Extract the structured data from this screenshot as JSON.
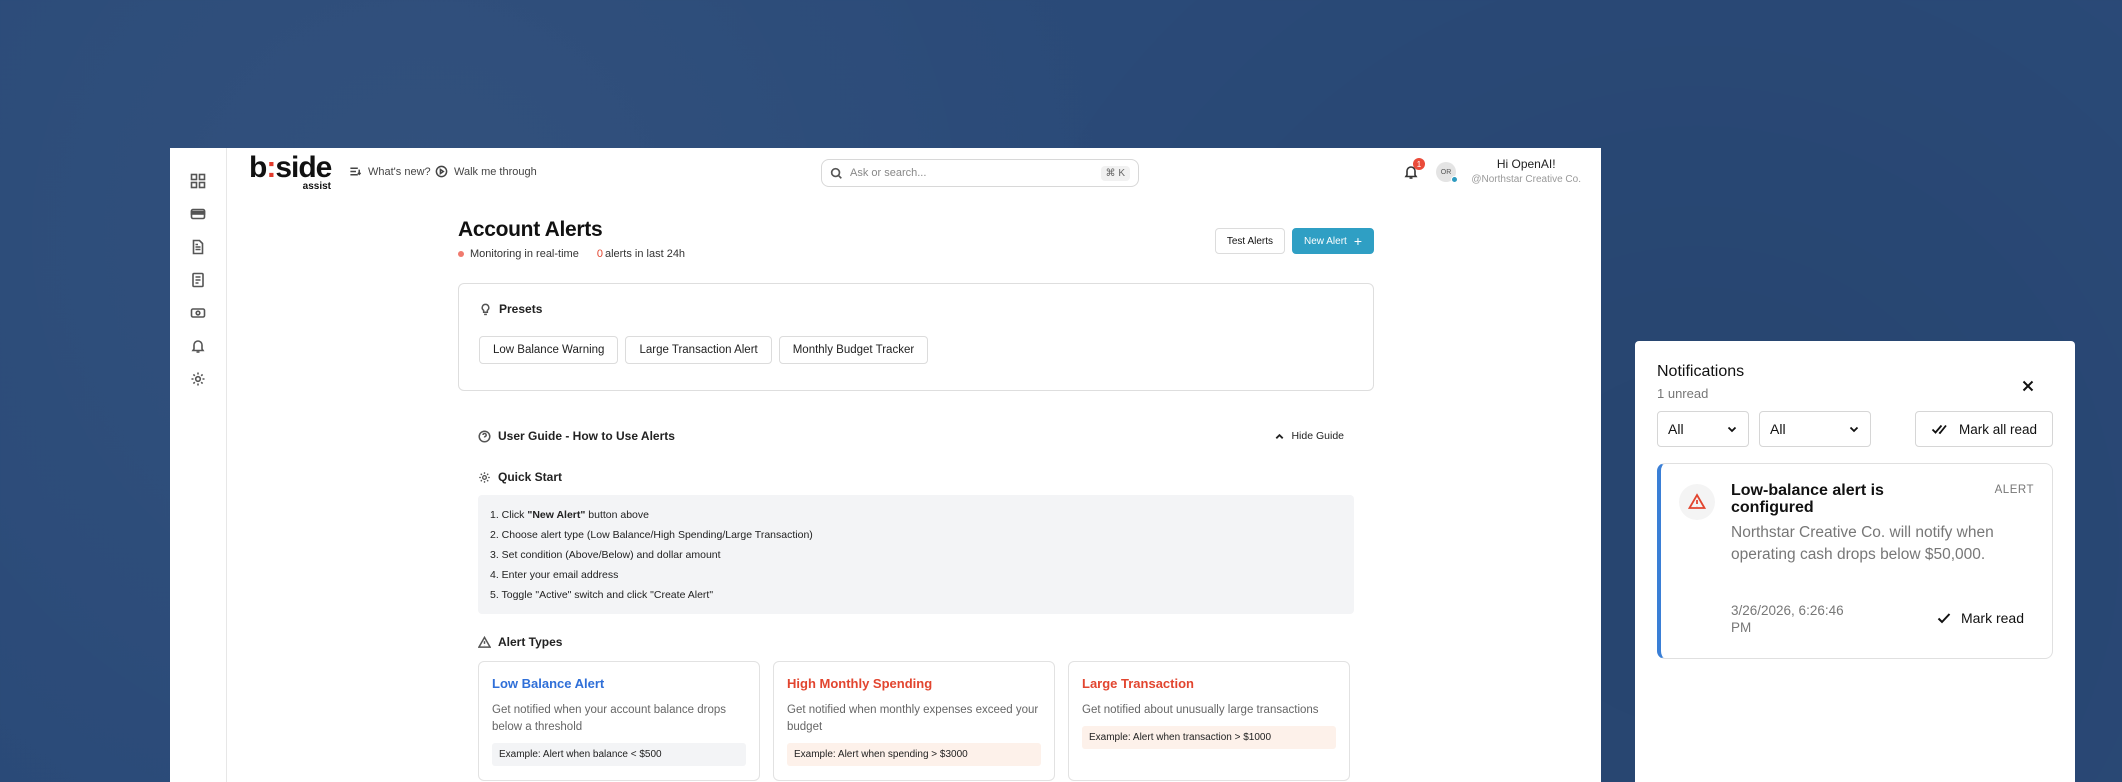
{
  "app": {
    "logo_word_a": "b",
    "logo_dot": ":",
    "logo_word_b": "side",
    "logo_sub": "assist",
    "nav": {
      "whats_new": "What's new?",
      "walk": "Walk me through"
    },
    "search": {
      "placeholder": "Ask or search...",
      "shortcut": "⌘ K"
    },
    "bell_badge": "1",
    "avatar_initials": "OR",
    "greeting": "Hi OpenAI!",
    "org": "@Northstar Creative Co."
  },
  "rail": {
    "items": [
      "dashboard-icon",
      "card-icon",
      "document-icon",
      "report-icon",
      "cash-icon",
      "bell-icon",
      "gear-icon"
    ]
  },
  "page": {
    "title": "Account Alerts",
    "monitoring": "Monitoring in real-time",
    "alerts_count": "0",
    "alerts_suffix": "alerts in last 24h",
    "test_alerts": "Test Alerts",
    "new_alert": "New Alert"
  },
  "presets": {
    "heading": "Presets",
    "items": [
      "Low Balance Warning",
      "Large Transaction Alert",
      "Monthly Budget Tracker"
    ]
  },
  "guide": {
    "heading": "User Guide - How to Use Alerts",
    "hide": "Hide Guide",
    "quick_start": "Quick Start",
    "steps": {
      "s1_pre": "1. Click ",
      "s1_bold": "\"New Alert\"",
      "s1_post": " button above",
      "s2": "2. Choose alert type (Low Balance/High Spending/Large Transaction)",
      "s3": "3. Set condition (Above/Below) and dollar amount",
      "s4": "4. Enter your email address",
      "s5": "5. Toggle \"Active\" switch and click \"Create Alert\""
    },
    "alert_types": "Alert Types",
    "cards": [
      {
        "title": "Low Balance Alert",
        "desc": "Get notified when your account balance drops below a threshold",
        "example": "Example: Alert when balance < $500",
        "color": "#2f6fd8",
        "bg": "#f3f4f6"
      },
      {
        "title": "High Monthly Spending",
        "desc": "Get notified when monthly expenses exceed your budget",
        "example": "Example: Alert when spending > $3000",
        "color": "#e2452f",
        "bg": "#fdf1ea"
      },
      {
        "title": "Large Transaction",
        "desc": "Get notified about unusually large transactions",
        "example": "Example: Alert when transaction > $1000",
        "color": "#e2452f",
        "bg": "#fdf1ea"
      }
    ]
  },
  "notifications": {
    "title": "Notifications",
    "unread": "1 unread",
    "filter1": "All",
    "filter2": "All",
    "mark_all": "Mark all read",
    "item": {
      "title": "Low-balance alert is configured",
      "tag": "ALERT",
      "body": "Northstar Creative Co. will notify when operating cash drops below $50,000.",
      "time": "3/26/2026, 6:26:46 PM",
      "mark_read": "Mark read"
    }
  }
}
